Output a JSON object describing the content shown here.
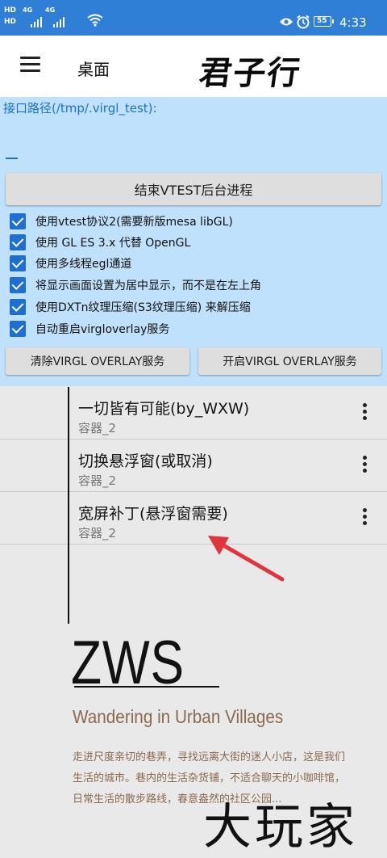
{
  "status_bar": {
    "time": "4:33",
    "battery_level": "55",
    "sim1": "HD",
    "sim2": "HD",
    "network1": "4G",
    "network2": "4G"
  },
  "app_bar": {
    "title": "桌面",
    "brand": "君子行"
  },
  "config": {
    "path_label": "接口路径(/tmp/.virgl_test):",
    "path_value": "",
    "stop_button": "结束VTEST后台进程",
    "options": [
      {
        "label": "使用vtest协议2(需要新版mesa libGL)",
        "checked": true
      },
      {
        "label": "使用 GL ES 3.x 代替 OpenGL",
        "checked": true
      },
      {
        "label": "使用多线程egl通道",
        "checked": true
      },
      {
        "label": "将显示画面设置为居中显示，而不是在左上角",
        "checked": true
      },
      {
        "label": "使用DXTn纹理压缩(S3纹理压缩) 来解压缩",
        "checked": true
      },
      {
        "label": "自动重启virgloverlay服务",
        "checked": true
      }
    ],
    "clear_button": "清除VIRGL OVERLAY服务",
    "start_button": "开启VIRGL OVERLAY服务"
  },
  "list": [
    {
      "title": "一切皆有可能(by_WXW)",
      "subtitle": "容器_2"
    },
    {
      "title": "切换悬浮窗(或取消)",
      "subtitle": "容器_2"
    },
    {
      "title": "宽屏补丁(悬浮窗需要)",
      "subtitle": "容器_2"
    }
  ],
  "annotation": {
    "arrow_color": "#e0353d"
  },
  "watermark": {
    "title": "ZWS",
    "subtitle": "Wandering in Urban Villages",
    "lines": [
      "走进尺度亲切的巷弄，寻找远离大街的迷人小店，这是我们",
      "生活的城市。巷内的生活杂货铺，不适合聊天的小咖啡馆，",
      "日常生活的散步路线，春意盎然的社区公园..."
    ],
    "brand": "大玩家"
  },
  "colors": {
    "status_bar": "#2f7fd6",
    "panel_bg": "#bfe1fb",
    "accent": "#1e72c7",
    "checkbox": "#1e6fd0",
    "list_bg": "#e9e9e9"
  }
}
